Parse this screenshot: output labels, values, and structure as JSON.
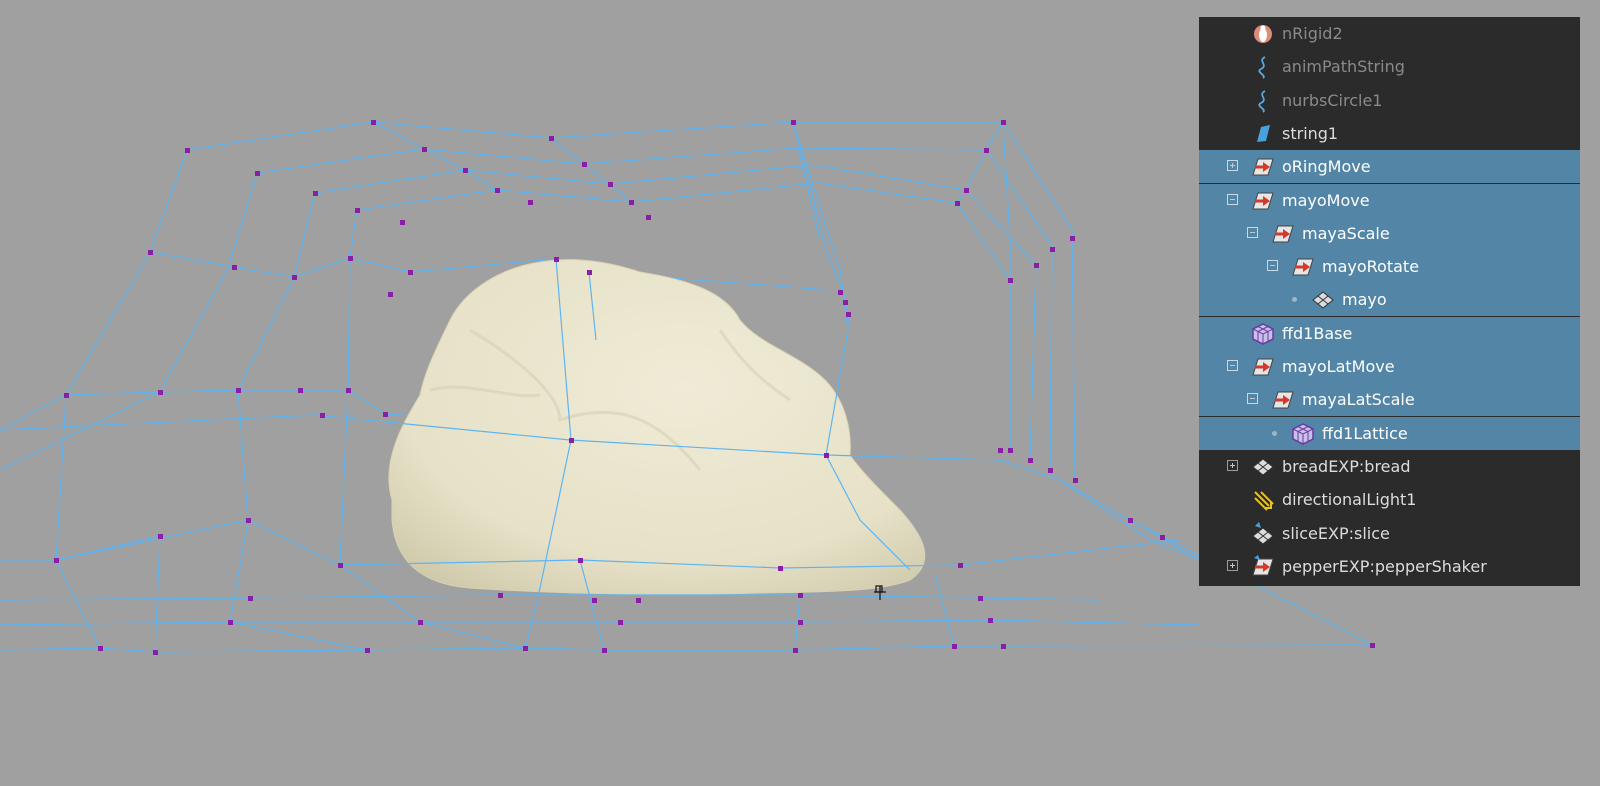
{
  "viewport": {
    "mesh_name": "mayo",
    "lattice_name": "ffd1Lattice",
    "colors": {
      "background": "#a0a0a0",
      "lattice_line": "#5fb4f0",
      "lattice_point": "#8a1fa6",
      "mesh_fill": "#ebe7d0"
    }
  },
  "outliner": {
    "colors": {
      "background": "#2b2b2b",
      "selection": "#5285a6"
    },
    "items": [
      {
        "label": "nRigid2",
        "icon": "nrigid-icon",
        "selected": false,
        "dim": true,
        "expander": "none"
      },
      {
        "label": "animPathString",
        "icon": "curve-icon",
        "selected": false,
        "dim": true,
        "expander": "none"
      },
      {
        "label": "nurbsCircle1",
        "icon": "curve-icon",
        "selected": false,
        "dim": true,
        "expander": "none"
      },
      {
        "label": "string1",
        "icon": "mesh-shape-icon",
        "selected": false,
        "dim": false,
        "expander": "none"
      },
      {
        "label": "oRingMove",
        "icon": "transform-icon",
        "selected": true,
        "dim": false,
        "expander": "plus"
      },
      {
        "label": "mayoMove",
        "icon": "transform-icon",
        "selected": true,
        "dim": false,
        "expander": "minus"
      },
      {
        "label": "mayaScale",
        "icon": "transform-icon",
        "selected": true,
        "dim": false,
        "expander": "minus"
      },
      {
        "label": "mayoRotate",
        "icon": "transform-icon",
        "selected": true,
        "dim": false,
        "expander": "minus"
      },
      {
        "label": "mayo",
        "icon": "mesh-icon",
        "selected": true,
        "dim": false,
        "expander": "leaf"
      },
      {
        "label": "ffd1Base",
        "icon": "lattice-icon",
        "selected": true,
        "dim": false,
        "expander": "none"
      },
      {
        "label": "mayoLatMove",
        "icon": "transform-icon",
        "selected": true,
        "dim": false,
        "expander": "minus"
      },
      {
        "label": "mayaLatScale",
        "icon": "transform-icon",
        "selected": true,
        "dim": false,
        "expander": "minus"
      },
      {
        "label": "ffd1Lattice",
        "icon": "lattice-icon",
        "selected": true,
        "dim": false,
        "expander": "leaf"
      },
      {
        "label": "breadEXP:bread",
        "icon": "mesh-icon",
        "selected": false,
        "dim": false,
        "expander": "plus"
      },
      {
        "label": "directionalLight1",
        "icon": "light-icon",
        "selected": false,
        "dim": false,
        "expander": "none"
      },
      {
        "label": "sliceEXP:slice",
        "icon": "mesh-ref-icon",
        "selected": false,
        "dim": false,
        "expander": "none"
      },
      {
        "label": "pepperEXP:pepperShaker",
        "icon": "transform-ref-icon",
        "selected": false,
        "dim": false,
        "expander": "plus"
      }
    ]
  }
}
